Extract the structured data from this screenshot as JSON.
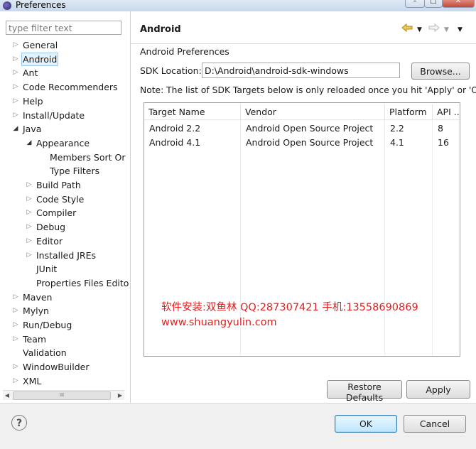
{
  "window": {
    "title": "Preferences"
  },
  "filter": {
    "placeholder": "type filter text"
  },
  "tree": [
    {
      "label": "General",
      "level": 0,
      "twisty": "closed"
    },
    {
      "label": "Android",
      "level": 0,
      "twisty": "closed",
      "selected": true
    },
    {
      "label": "Ant",
      "level": 0,
      "twisty": "closed"
    },
    {
      "label": "Code Recommenders",
      "level": 0,
      "twisty": "closed"
    },
    {
      "label": "Help",
      "level": 0,
      "twisty": "closed"
    },
    {
      "label": "Install/Update",
      "level": 0,
      "twisty": "closed"
    },
    {
      "label": "Java",
      "level": 0,
      "twisty": "open"
    },
    {
      "label": "Appearance",
      "level": 1,
      "twisty": "open"
    },
    {
      "label": "Members Sort Or",
      "level": 2,
      "twisty": "none"
    },
    {
      "label": "Type Filters",
      "level": 2,
      "twisty": "none"
    },
    {
      "label": "Build Path",
      "level": 1,
      "twisty": "closed"
    },
    {
      "label": "Code Style",
      "level": 1,
      "twisty": "closed"
    },
    {
      "label": "Compiler",
      "level": 1,
      "twisty": "closed"
    },
    {
      "label": "Debug",
      "level": 1,
      "twisty": "closed"
    },
    {
      "label": "Editor",
      "level": 1,
      "twisty": "closed"
    },
    {
      "label": "Installed JREs",
      "level": 1,
      "twisty": "closed"
    },
    {
      "label": "JUnit",
      "level": 1,
      "twisty": "none"
    },
    {
      "label": "Properties Files Edito",
      "level": 1,
      "twisty": "none"
    },
    {
      "label": "Maven",
      "level": 0,
      "twisty": "closed"
    },
    {
      "label": "Mylyn",
      "level": 0,
      "twisty": "closed"
    },
    {
      "label": "Run/Debug",
      "level": 0,
      "twisty": "closed"
    },
    {
      "label": "Team",
      "level": 0,
      "twisty": "closed"
    },
    {
      "label": "Validation",
      "level": 0,
      "twisty": "none"
    },
    {
      "label": "WindowBuilder",
      "level": 0,
      "twisty": "closed"
    },
    {
      "label": "XML",
      "level": 0,
      "twisty": "closed"
    }
  ],
  "hscroll": {
    "thumb_grip": "III"
  },
  "page": {
    "title": "Android",
    "section_label": "Android Preferences",
    "sdk_label": "SDK Location:",
    "sdk_value": "D:\\Android\\android-sdk-windows",
    "browse_label": "Browse...",
    "note": "Note: The list of SDK Targets below is only reloaded once you hit 'Apply' or 'OK'.",
    "table": {
      "columns": [
        "Target Name",
        "Vendor",
        "Platform",
        "API ..."
      ],
      "rows": [
        [
          "Android 2.2",
          "Android Open Source Project",
          "2.2",
          "8"
        ],
        [
          "Android 4.1",
          "Android Open Source Project",
          "4.1",
          "16"
        ]
      ]
    },
    "watermark_line1": "软件安装:双鱼林 QQ:287307421 手机:13558690869",
    "watermark_line2": "www.shuangyulin.com",
    "restore_defaults_label": "Restore Defaults",
    "apply_label": "Apply"
  },
  "footer": {
    "ok_label": "OK",
    "cancel_label": "Cancel",
    "help_glyph": "?"
  },
  "icons": {
    "back": "back-arrow-icon",
    "forward": "forward-arrow-icon",
    "menu": "view-menu-icon"
  },
  "colors": {
    "watermark": "#e02020",
    "selection_bg": "#e5f1fb",
    "back_arrow": "#e8b830"
  }
}
